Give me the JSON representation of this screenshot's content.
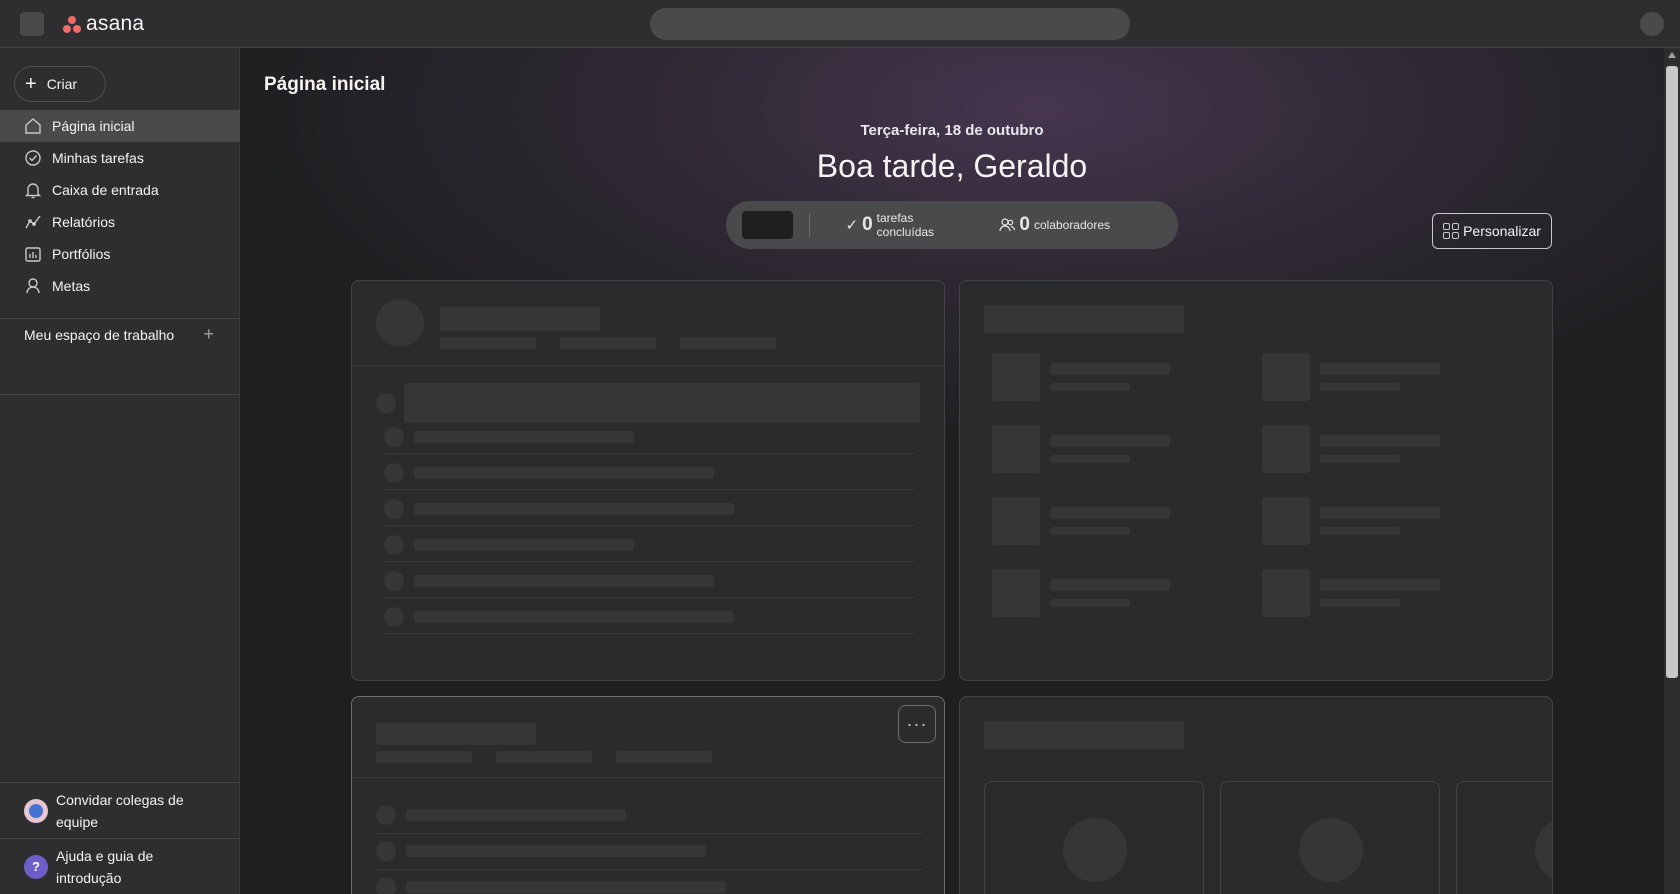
{
  "brand": {
    "name": "asana",
    "logo_color": "#f06a6a"
  },
  "sidebar": {
    "create_label": "Criar",
    "items": [
      {
        "label": "Página inicial",
        "icon": "home-icon",
        "active": true
      },
      {
        "label": "Minhas tarefas",
        "icon": "check-circle-icon",
        "active": false
      },
      {
        "label": "Caixa de entrada",
        "icon": "bell-icon",
        "active": false
      },
      {
        "label": "Relatórios",
        "icon": "line-chart-icon",
        "active": false
      },
      {
        "label": "Portfólios",
        "icon": "portfolio-icon",
        "active": false
      },
      {
        "label": "Metas",
        "icon": "goal-icon",
        "active": false
      }
    ],
    "workspace_label": "Meu espaço de trabalho",
    "invite_label": "Convidar colegas de equipe",
    "help_label": "Ajuda e guia de introdução",
    "help_icon_text": "?"
  },
  "main": {
    "page_title": "Página inicial",
    "date": "Terça-feira, 18 de outubro",
    "greeting": "Boa tarde, Geraldo",
    "stats": {
      "tasks_count": "0",
      "tasks_label": "tarefas concluídas",
      "collab_count": "0",
      "collab_label": "colaboradores"
    },
    "personalize_label": "Personalizar",
    "more_label": "···"
  },
  "colors": {
    "accent": "#f06a6a",
    "background": "#1e1f21",
    "sidebar": "#2e2e30",
    "help_badge": "#6d5ec8"
  }
}
